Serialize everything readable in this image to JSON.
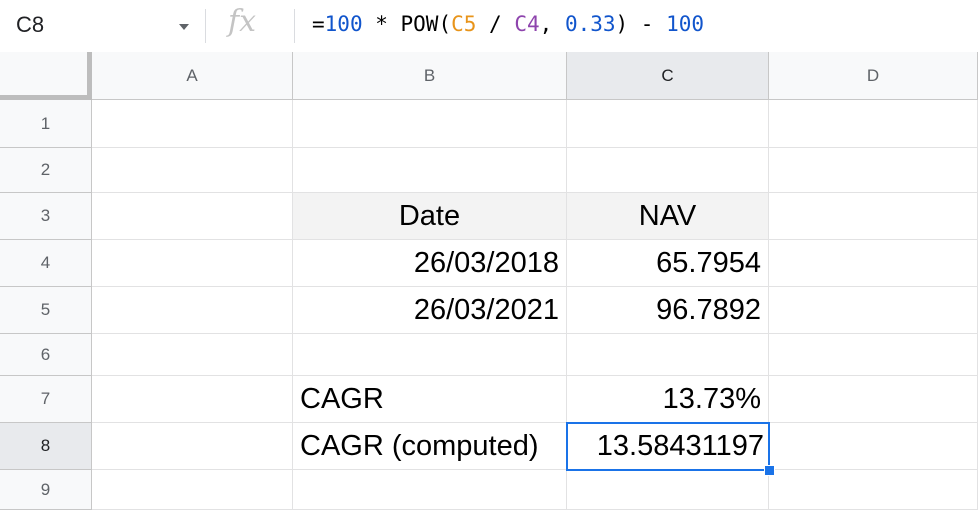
{
  "formula_bar": {
    "name_box": "C8",
    "fx_label": "fx",
    "formula_parts": [
      {
        "text": "=",
        "cls": ""
      },
      {
        "text": "100",
        "cls": "num"
      },
      {
        "text": " * POW(",
        "cls": ""
      },
      {
        "text": "C5",
        "cls": "r1"
      },
      {
        "text": " / ",
        "cls": ""
      },
      {
        "text": "C4",
        "cls": "r2"
      },
      {
        "text": ", ",
        "cls": ""
      },
      {
        "text": "0.33",
        "cls": "num"
      },
      {
        "text": ") - ",
        "cls": ""
      },
      {
        "text": "100",
        "cls": "num"
      }
    ]
  },
  "columns": [
    "A",
    "B",
    "C",
    "D"
  ],
  "rows": [
    "1",
    "2",
    "3",
    "4",
    "5",
    "6",
    "7",
    "8",
    "9"
  ],
  "selected": {
    "col": "C",
    "row": "8"
  },
  "cells": {
    "B3": "Date",
    "C3": "NAV",
    "B4": "26/03/2018",
    "C4": "65.7954",
    "B5": "26/03/2021",
    "C5": "96.7892",
    "B7": "CAGR",
    "C7": "13.73%",
    "B8": "CAGR (computed)",
    "C8": "13.58431197"
  },
  "colors": {
    "selection": "#1a73e8",
    "number_literal": "#1155cc",
    "ref_c5": "#e8941a",
    "ref_c4": "#8e44ad",
    "header_gray": "#f3f3f3"
  }
}
